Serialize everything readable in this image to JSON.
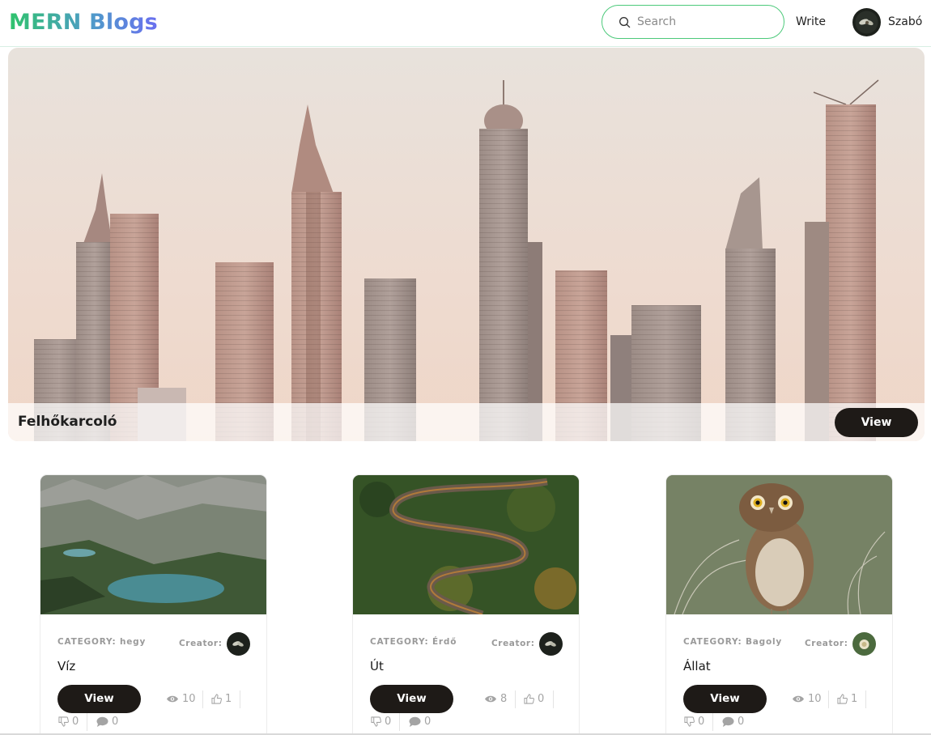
{
  "app": {
    "logo": "MERN Blogs"
  },
  "nav": {
    "search_placeholder": "Search",
    "write_label": "Write",
    "user_name": "Szabó"
  },
  "hero": {
    "title": "Felhőkarcoló",
    "view_label": "View"
  },
  "cards": [
    {
      "category": "CATEGORY: hegy",
      "creator_label": "Creator:",
      "title": "Víz",
      "view_label": "View",
      "views": "10",
      "likes": "1",
      "dislikes": "0",
      "comments": "0"
    },
    {
      "category": "CATEGORY: Érdő",
      "creator_label": "Creator:",
      "title": "Út",
      "view_label": "View",
      "views": "8",
      "likes": "0",
      "dislikes": "0",
      "comments": "0"
    },
    {
      "category": "CATEGORY: Bagoly",
      "creator_label": "Creator:",
      "title": "Állat",
      "view_label": "View",
      "views": "10",
      "likes": "1",
      "dislikes": "0",
      "comments": "0"
    }
  ],
  "colors": {
    "accent_green": "#4cc97a",
    "button_dark": "#1e1a17",
    "muted_text": "#9a9a9a"
  },
  "icons": [
    "search-icon",
    "eye-icon",
    "thumbs-up-icon",
    "thumbs-down-icon",
    "comment-icon"
  ]
}
